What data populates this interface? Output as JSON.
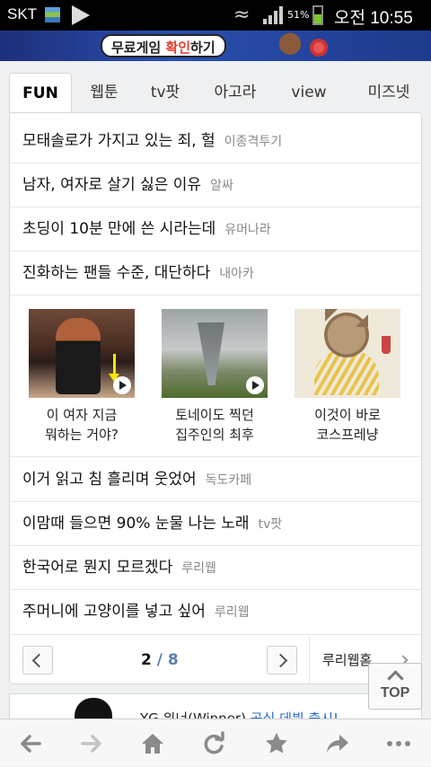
{
  "statusbar": {
    "carrier": "SKT",
    "battery_pct": "51%",
    "time": "오전 10:55"
  },
  "banner": {
    "text_pre": "무료게임 ",
    "text_hl": "확인",
    "text_post": "하기"
  },
  "tabs": [
    {
      "label": "FUN"
    },
    {
      "label": "웹툰"
    },
    {
      "label": "tv팟"
    },
    {
      "label": "아고라"
    },
    {
      "label": "view"
    },
    {
      "label": "미즈넷"
    }
  ],
  "top_list": [
    {
      "title": "모태솔로가 가지고 있는 죄, 헐",
      "source": "이종격투기"
    },
    {
      "title": "남자, 여자로 살기 싫은 이유",
      "source": "알싸"
    },
    {
      "title": "초딩이 10분 만에 쓴 시라는데",
      "source": "유머나라"
    },
    {
      "title": "진화하는 팬들 수준, 대단하다",
      "source": "내아카"
    }
  ],
  "thumbs": [
    {
      "line1": "이 여자 지금",
      "line2": "뭐하는 거야?"
    },
    {
      "line1": "토네이도 찍던",
      "line2": "집주인의 최후"
    },
    {
      "line1": "이것이 바로",
      "line2": "코스프레냥"
    }
  ],
  "bottom_list": [
    {
      "title": "이거 읽고 침 흘리며 웃었어",
      "source": "독도카페"
    },
    {
      "title": "이맘때 들으면 90% 눈물 나는 노래",
      "source": "tv팟"
    },
    {
      "title": "한국어로 뭔지 모르겠다",
      "source": "루리웹"
    },
    {
      "title": "주머니에 고양이를 넣고 싶어",
      "source": "루리웹"
    }
  ],
  "pager": {
    "current": "2",
    "sep": " / ",
    "total": "8",
    "link": "루리웹홈"
  },
  "teaser": {
    "text": "YG 위너(Winner) ",
    "link": "공식 데뷔 출시!"
  },
  "top_button": {
    "label": "TOP"
  },
  "colors": {
    "accent": "#5b8fd6",
    "link": "#2a6ad0"
  }
}
